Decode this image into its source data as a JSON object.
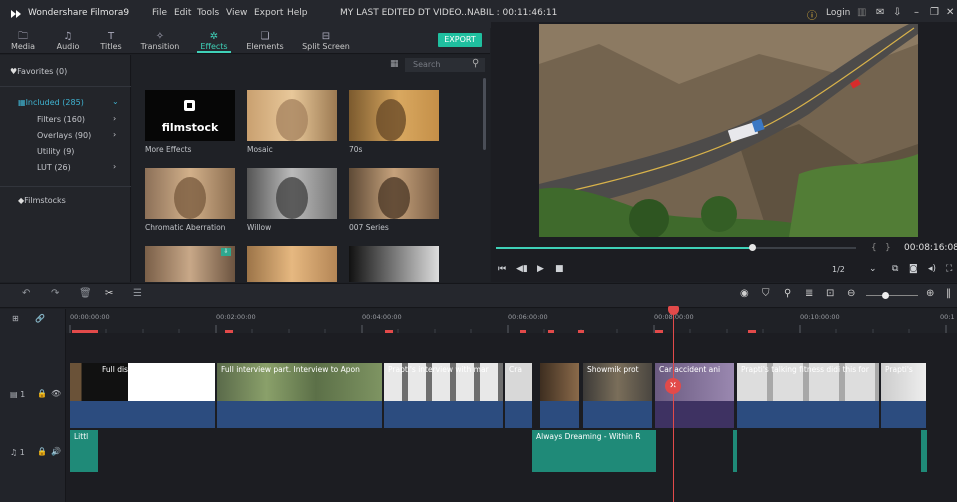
{
  "app": {
    "name": "Wondershare Filmora9",
    "menus": [
      "File",
      "Edit",
      "Tools",
      "View",
      "Export",
      "Help"
    ],
    "document_title": "MY LAST EDITED DT VIDEO..NABIL : 00:11:46:11",
    "login_label": "Login"
  },
  "toolbar": {
    "tabs": [
      "Media",
      "Audio",
      "Titles",
      "Transition",
      "Effects",
      "Elements",
      "Split Screen"
    ],
    "export_label": "EXPORT"
  },
  "sidebar": {
    "favorites": "Favorites (0)",
    "included": "Included (285)",
    "items": [
      "Filters (160)",
      "Overlays (90)",
      "Utility (9)",
      "LUT (26)"
    ],
    "filmstocks": "Filmstocks"
  },
  "search": {
    "placeholder": "Search"
  },
  "effects": [
    {
      "label": "More Effects"
    },
    {
      "label": "Mosaic"
    },
    {
      "label": "70s"
    },
    {
      "label": "Chromatic Aberration"
    },
    {
      "label": "Willow"
    },
    {
      "label": "007 Series"
    }
  ],
  "filmstock_logo": "filmstock",
  "preview": {
    "timecode": "00:08:16:08",
    "quality": "1/2",
    "progress": 0.71
  },
  "timeline": {
    "ticks": [
      "00:00:00:00",
      "00:02:00:00",
      "00:04:00:00",
      "00:06:00:00",
      "00:08:00:00",
      "00:10:00:00",
      "00:1"
    ],
    "video_track_label": "1",
    "audio_track_label": "1",
    "video_clips": [
      "Full discussion part with Sh",
      "Full interview part. Interview to Apon",
      "Prapti's interview with mar",
      "Cra",
      "Showmik prot",
      "Car accident ani",
      "Prapti's talking fitness didi this for",
      "Prapti's"
    ],
    "audio_clips": [
      "Littl",
      "Always Dreaming - Within R"
    ]
  },
  "colors": {
    "accent": "#3fd1b8",
    "video_clip": "#2e4a74",
    "audio_clip": "#1f8a78",
    "playhead": "#e24a4a"
  }
}
